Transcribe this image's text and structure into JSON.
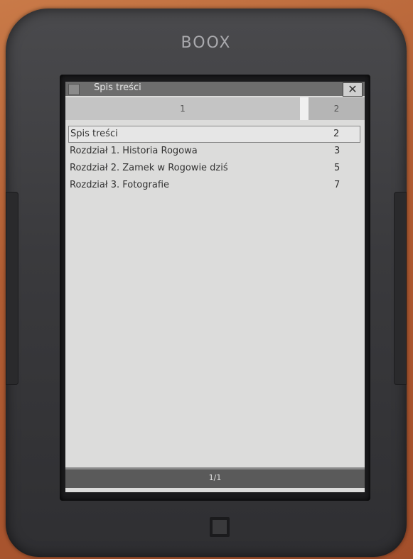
{
  "device": {
    "brand": "BOOX"
  },
  "dialog": {
    "title": "Spis treści",
    "close_icon": "close-icon",
    "tabs": [
      "1",
      "2"
    ],
    "entries": [
      {
        "label": "Spis treści",
        "page": "2",
        "selected": true
      },
      {
        "label": "Rozdział 1. Historia Rogowa",
        "page": "3",
        "selected": false
      },
      {
        "label": "Rozdział 2. Zamek w Rogowie dziś",
        "page": "5",
        "selected": false
      },
      {
        "label": "Rozdział 3. Fotografie",
        "page": "7",
        "selected": false
      }
    ],
    "page_counter": "1/1"
  },
  "colors": {
    "screen": "#dcdcdb",
    "title_bar": "#6d6d6d",
    "bezel": "#3a3a3d"
  }
}
